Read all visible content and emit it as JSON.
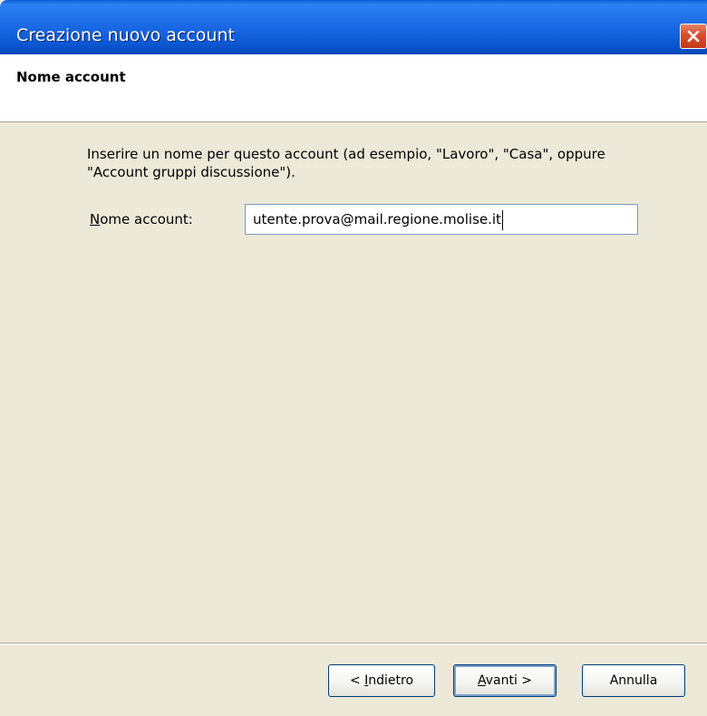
{
  "window": {
    "title": "Creazione nuovo account"
  },
  "header": {
    "title": "Nome account"
  },
  "content": {
    "instruction": "Inserire un nome per questo account (ad esempio, \"Lavoro\", \"Casa\", oppure \"Account gruppi discussione\").",
    "field": {
      "label_mnemonic": "N",
      "label_rest": "ome account:",
      "value": "utente.prova@mail.regione.molise.it"
    }
  },
  "buttons": {
    "back": {
      "prefix": "< ",
      "mnemonic": "I",
      "rest": "ndietro"
    },
    "next": {
      "mnemonic": "A",
      "rest": "vanti >"
    },
    "cancel": {
      "label": "Annulla"
    }
  },
  "colors": {
    "titlebar": "#0A55D0",
    "dialog_bg": "#ECE9D8",
    "close_button": "#D8502E"
  },
  "icons": {
    "close": "close-icon"
  }
}
